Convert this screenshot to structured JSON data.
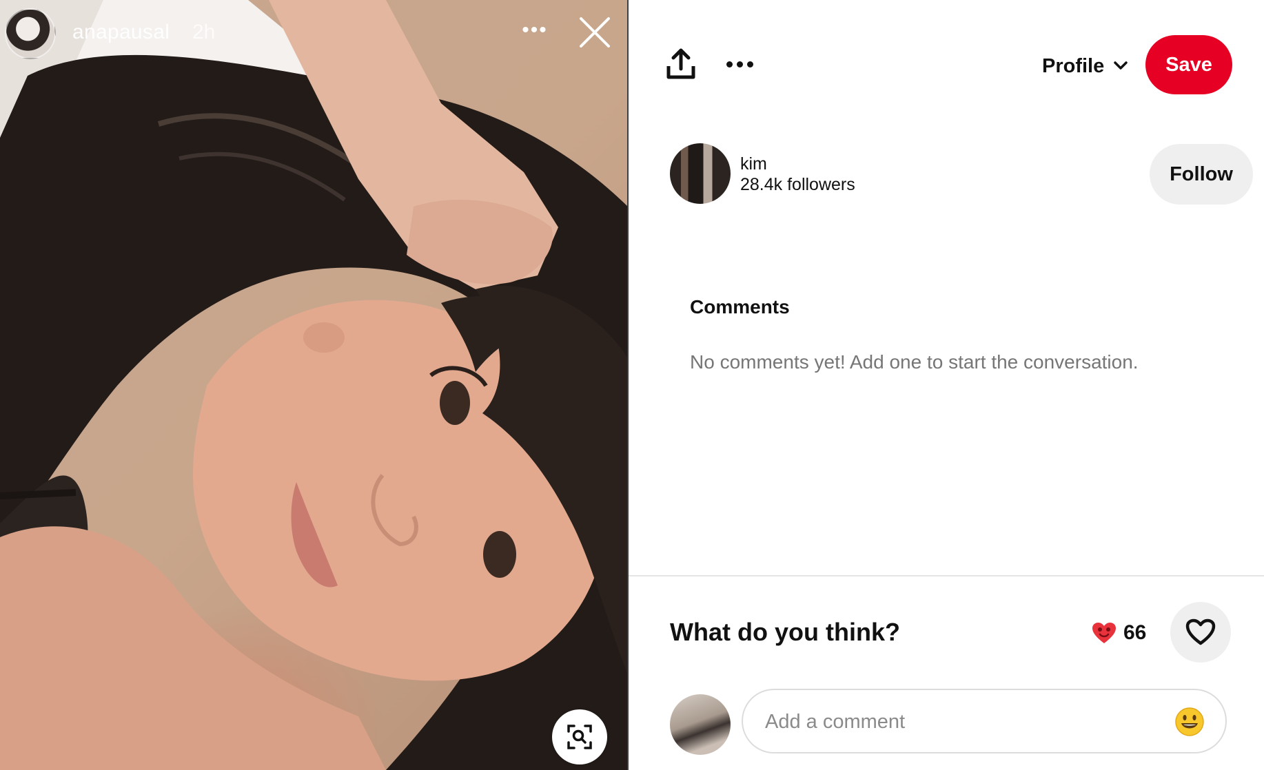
{
  "story": {
    "username": "anapausal",
    "time": "2h",
    "more_label": "•••"
  },
  "toolbar": {
    "profile_label": "Profile",
    "save_label": "Save"
  },
  "creator": {
    "name": "kim",
    "followers": "28.4k followers",
    "follow_label": "Follow"
  },
  "comments": {
    "heading": "Comments",
    "empty_text": "No comments yet! Add one to start the conversation."
  },
  "feedback": {
    "prompt": "What do you think?",
    "reaction_count": "66"
  },
  "comment_box": {
    "placeholder": "Add a comment"
  },
  "icons": {
    "share": "share-upload-icon",
    "more": "ellipsis-icon",
    "chevron": "chevron-down-icon",
    "close": "close-icon",
    "visual_search": "visual-search-icon",
    "reaction": "heart-eyes-emoji-icon",
    "heart": "heart-outline-icon",
    "emoji": "smiley-emoji-icon"
  },
  "colors": {
    "save_red": "#e60023",
    "follow_bg": "#efefef",
    "muted_text": "#767676"
  }
}
